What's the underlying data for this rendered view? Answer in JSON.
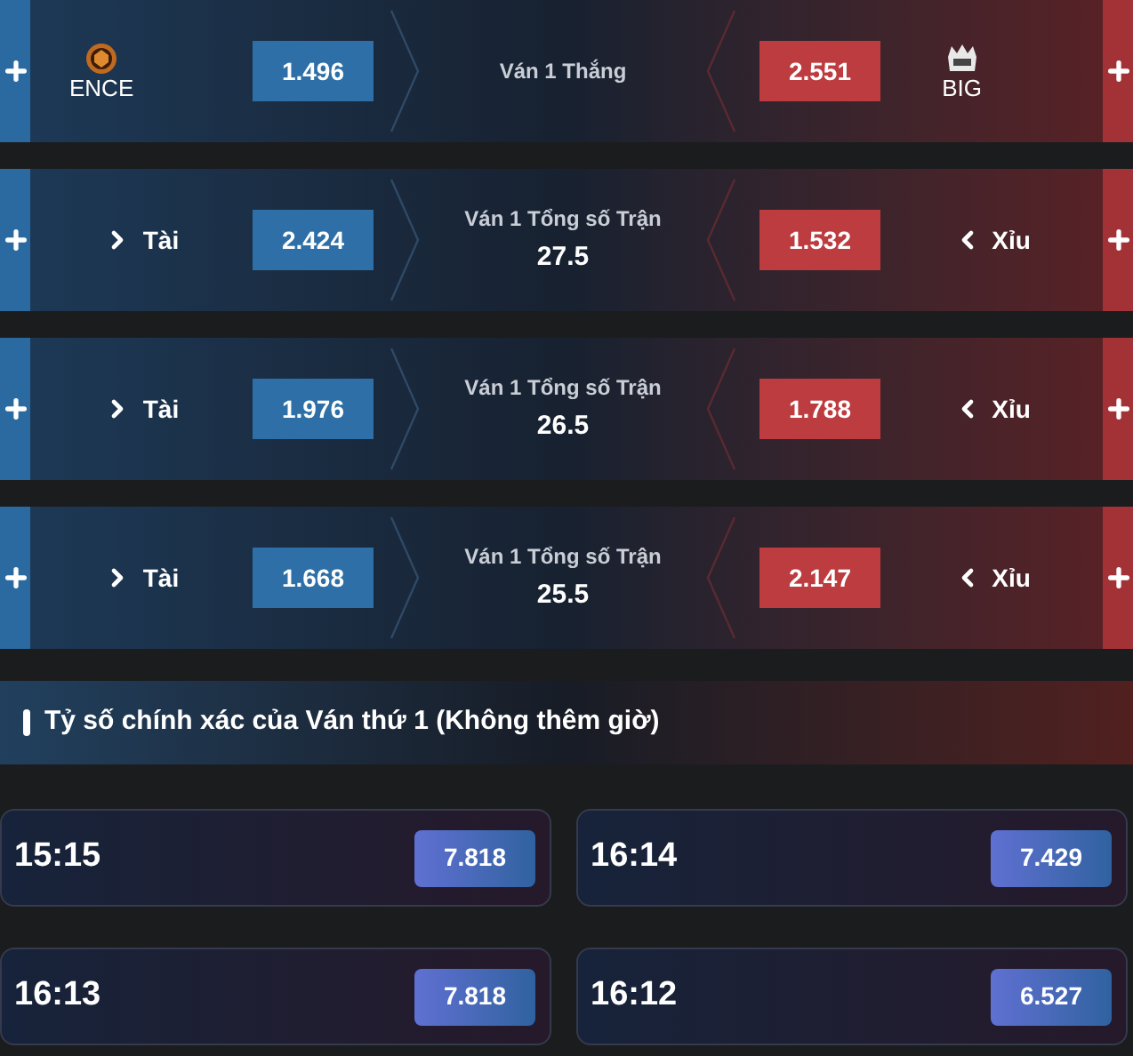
{
  "markets": [
    {
      "kind": "team",
      "left": {
        "name": "ENCE",
        "odds": "1.496"
      },
      "title": "Ván 1 Thắng",
      "right": {
        "name": "BIG",
        "odds": "2.551"
      }
    },
    {
      "kind": "total",
      "left": {
        "name": "Tài",
        "odds": "2.424"
      },
      "title": "Ván 1 Tổng số Trận",
      "line": "27.5",
      "right": {
        "name": "Xỉu",
        "odds": "1.532"
      }
    },
    {
      "kind": "total",
      "left": {
        "name": "Tài",
        "odds": "1.976"
      },
      "title": "Ván 1 Tổng số Trận",
      "line": "26.5",
      "right": {
        "name": "Xỉu",
        "odds": "1.788"
      }
    },
    {
      "kind": "total",
      "left": {
        "name": "Tài",
        "odds": "1.668"
      },
      "title": "Ván 1 Tổng số Trận",
      "line": "25.5",
      "right": {
        "name": "Xỉu",
        "odds": "2.147"
      }
    }
  ],
  "section": {
    "title": "Tỷ số chính xác của Ván thứ 1 (Không thêm giờ)"
  },
  "scores": [
    {
      "score": "15:15",
      "odds": "7.818"
    },
    {
      "score": "16:14",
      "odds": "7.429"
    },
    {
      "score": "16:13",
      "odds": "7.818"
    },
    {
      "score": "16:12",
      "odds": "6.527"
    }
  ]
}
